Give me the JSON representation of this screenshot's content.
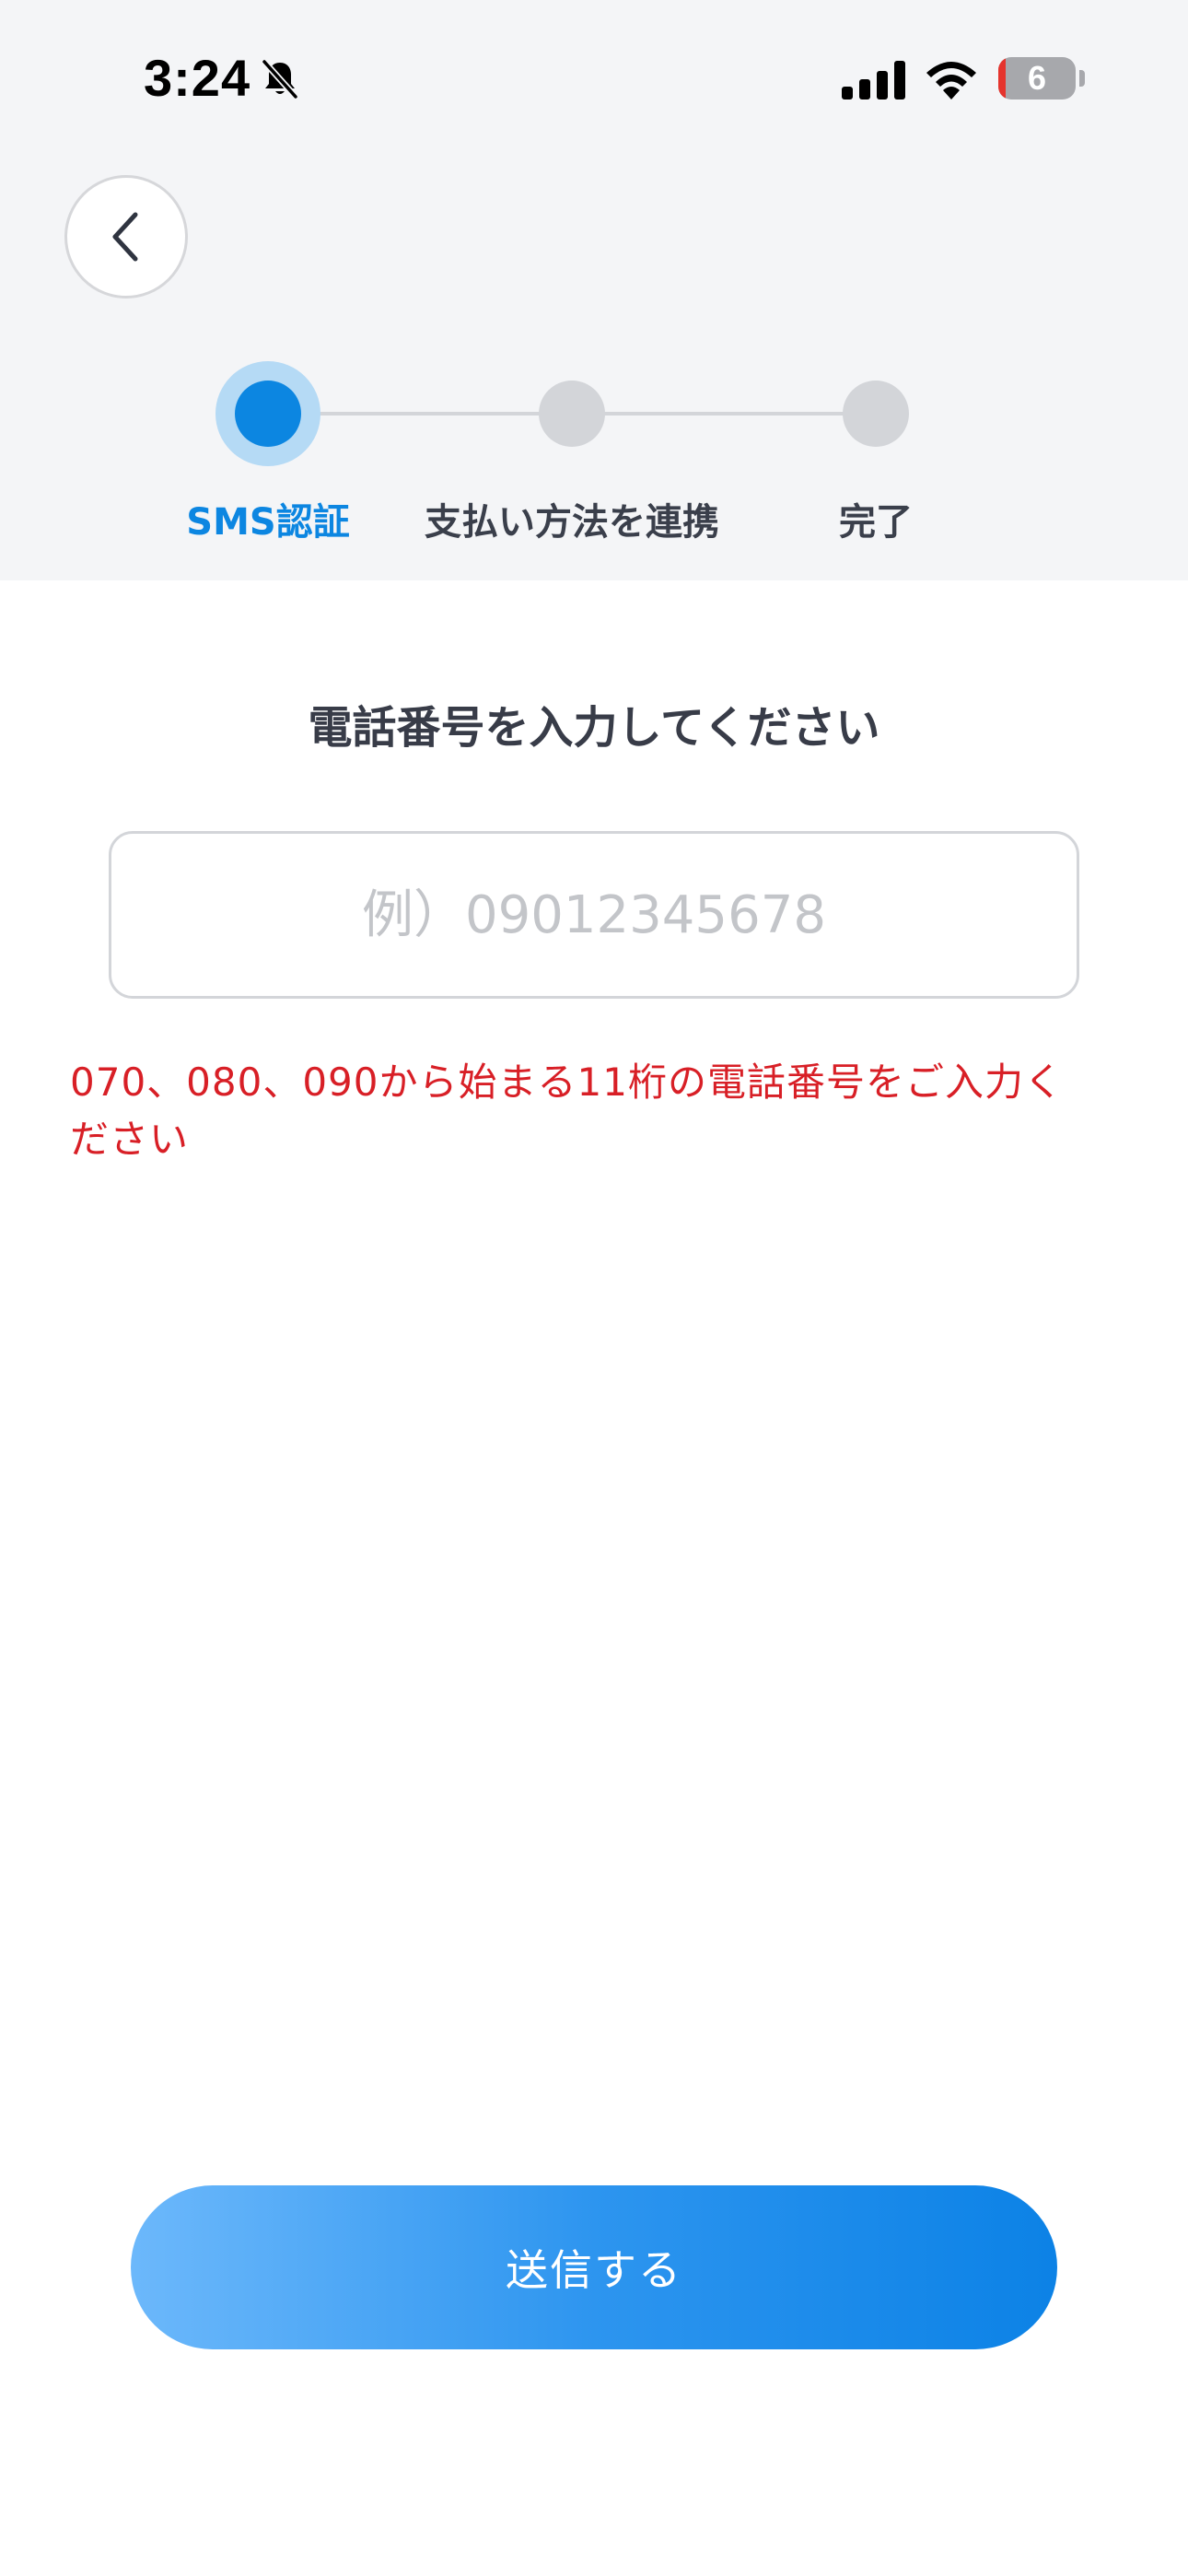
{
  "status_bar": {
    "time": "3:24",
    "battery_level": "6",
    "icons": [
      "bell-slash-icon",
      "cellular-signal-icon",
      "wifi-icon",
      "battery-icon"
    ]
  },
  "header": {
    "back_icon": "chevron-left-icon"
  },
  "stepper": {
    "current_step": 1,
    "steps": [
      {
        "label": "SMS認証"
      },
      {
        "label": "支払い方法を連携"
      },
      {
        "label": "完了"
      }
    ]
  },
  "main": {
    "title": "電話番号を入力してください",
    "phone_input": {
      "value": "",
      "placeholder": "例）09012345678"
    },
    "error_message": "070、080、090から始まる11桁の電話番号をご入力ください"
  },
  "footer": {
    "submit_label": "送信する"
  },
  "colors": {
    "accent": "#0c86e1",
    "error": "#d81f26",
    "header_bg": "#f4f5f7",
    "inactive_step": "#d3d5d9"
  }
}
